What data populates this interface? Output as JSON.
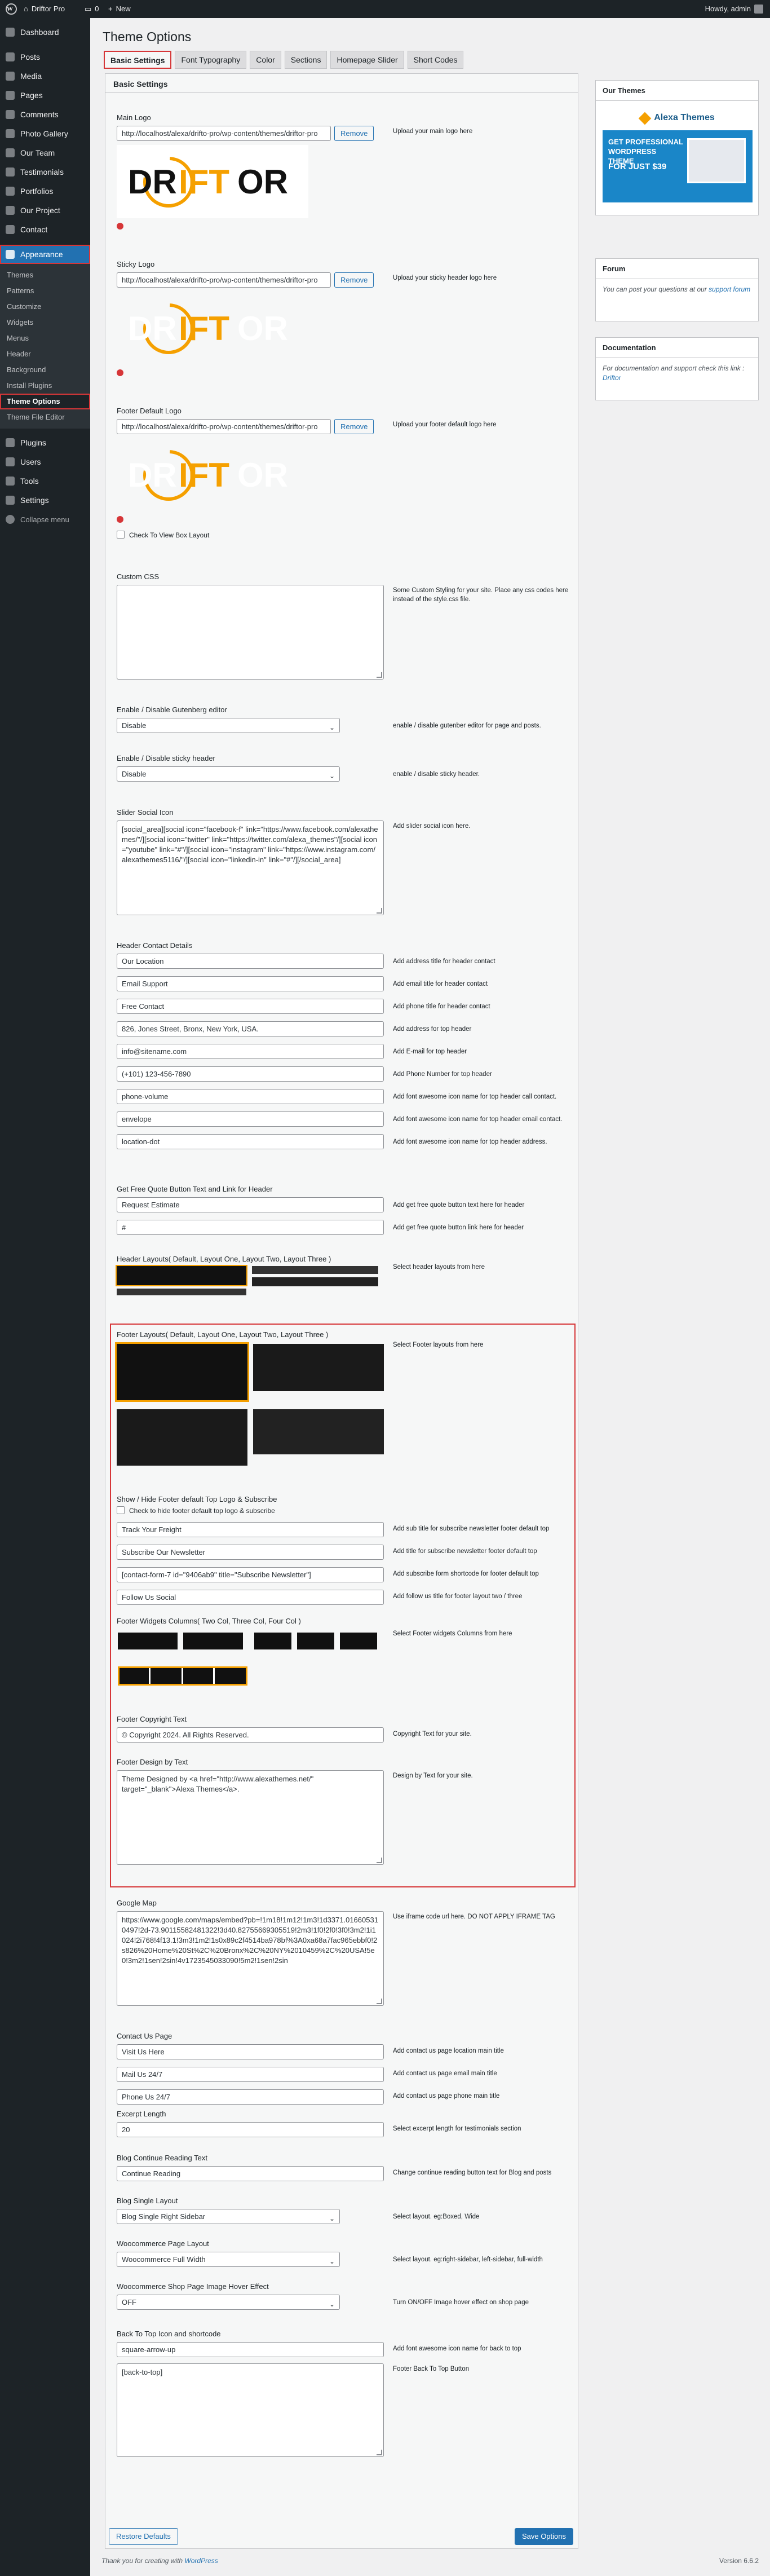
{
  "adminbar": {
    "site": "Driftor Pro",
    "comments": "0",
    "new": "New",
    "howdy": "Howdy, admin"
  },
  "sidebar": {
    "top": [
      "Dashboard"
    ],
    "items": [
      "Posts",
      "Media",
      "Pages",
      "Comments",
      "Photo Gallery",
      "Our Team",
      "Testimonials",
      "Portfolios",
      "Our Project",
      "Contact"
    ],
    "appearance": "Appearance",
    "appearance_sub": [
      "Themes",
      "Patterns",
      "Customize",
      "Widgets",
      "Menus",
      "Header",
      "Background",
      "Install Plugins",
      "Theme Options",
      "Theme File Editor"
    ],
    "bottom": [
      "Plugins",
      "Users",
      "Tools",
      "Settings",
      "Collapse menu"
    ]
  },
  "page": {
    "title": "Theme Options",
    "tabs": [
      "Basic Settings",
      "Font Typography",
      "Color",
      "Sections",
      "Homepage Slider",
      "Short Codes"
    ],
    "panel_title": "Basic Settings"
  },
  "fields": {
    "main_logo": {
      "label": "Main Logo",
      "value": "http://localhost/alexa/drifto-pro/wp-content/themes/driftor-pro",
      "remove": "Remove",
      "desc": "Upload your main logo here"
    },
    "sticky_logo": {
      "label": "Sticky Logo",
      "value": "http://localhost/alexa/drifto-pro/wp-content/themes/driftor-pro",
      "remove": "Remove",
      "desc": "Upload your sticky header logo here"
    },
    "footer_logo": {
      "label": "Footer Default Logo",
      "value": "http://localhost/alexa/drifto-pro/wp-content/themes/driftor-pro",
      "remove": "Remove",
      "desc": "Upload your footer default logo here"
    },
    "box_layout": "Check To View Box Layout",
    "custom_css": {
      "label": "Custom CSS",
      "value": "",
      "desc": "Some Custom Styling for your site. Place any css codes here instead of the style.css file."
    },
    "gutenberg": {
      "label": "Enable / Disable Gutenberg editor",
      "value": "Disable",
      "desc": "enable / disable gutenber editor for page and posts."
    },
    "sticky_header": {
      "label": "Enable / Disable sticky header",
      "value": "Disable",
      "desc": "enable / disable sticky header."
    },
    "slider_social": {
      "label": "Slider Social Icon",
      "value": "[social_area][social icon=\"facebook-f\" link=\"https://www.facebook.com/alexathemes/\"/][social icon=\"twitter\" link=\"https://twitter.com/alexa_themes\"/][social icon=\"youtube\" link=\"#\"/][social icon=\"instagram\" link=\"https://www.instagram.com/alexathemes5116/\"/][social icon=\"linkedin-in\" link=\"#\"/][/social_area]",
      "desc": "Add slider social icon here."
    },
    "header_contact": {
      "label": "Header Contact Details",
      "rows": [
        {
          "value": "Our Location",
          "desc": "Add address title for header contact"
        },
        {
          "value": "Email Support",
          "desc": "Add email title for header contact"
        },
        {
          "value": "Free Contact",
          "desc": "Add phone title for header contact"
        },
        {
          "value": "826, Jones Street, Bronx, New York, USA.",
          "desc": "Add address for top header"
        },
        {
          "value": "info@sitename.com",
          "desc": "Add E-mail for top header"
        },
        {
          "value": "(+101) 123-456-7890",
          "desc": "Add Phone Number for top header"
        },
        {
          "value": "phone-volume",
          "desc": "Add font awesome icon name for top header call contact."
        },
        {
          "value": "envelope",
          "desc": "Add font awesome icon name for top header email contact."
        },
        {
          "value": "location-dot",
          "desc": "Add font awesome icon name for top header address."
        }
      ]
    },
    "quote": {
      "label": "Get Free Quote Button Text and Link for Header",
      "rows": [
        {
          "value": "Request Estimate",
          "desc": "Add get free quote button text here for header"
        },
        {
          "value": "#",
          "desc": "Add get free quote button link here for header"
        }
      ]
    },
    "header_layouts": {
      "label": "Header Layouts( Default, Layout One, Layout Two, Layout Three )",
      "desc": "Select header layouts from here"
    },
    "footer_layouts": {
      "label": "Footer Layouts( Default, Layout One, Layout Two, Layout Three )",
      "desc": "Select Footer layouts from here"
    },
    "footer_top": {
      "label": "Show / Hide Footer default Top Logo & Subscribe",
      "check": "Check to hide footer default top logo & subscribe",
      "rows": [
        {
          "value": "Track Your Freight",
          "desc": "Add sub title for subscribe newsletter footer default top"
        },
        {
          "value": "Subscribe Our Newsletter",
          "desc": "Add title for subscribe newsletter footer default top"
        },
        {
          "value": "[contact-form-7 id=\"9406ab9\" title=\"Subscribe Newsletter\"]",
          "desc": "Add subscribe form shortcode for footer default top"
        },
        {
          "value": "Follow Us Social",
          "desc": "Add follow us title for footer layout two / three"
        }
      ]
    },
    "footer_columns": {
      "label": "Footer Widgets Columns( Two Col, Three Col, Four Col )",
      "desc": "Select Footer widgets Columns from here"
    },
    "copyright": {
      "label": "Footer Copyright Text",
      "value": "© Copyright 2024. All Rights Reserved.",
      "desc": "Copyright Text for your site."
    },
    "design_by": {
      "label": "Footer Design by Text",
      "value": "Theme Designed by <a href=\"http://www.alexathemes.net/\" target=\"_blank\">Alexa Themes</a>.",
      "desc": "Design by Text for your site."
    },
    "google_map": {
      "label": "Google Map",
      "value": "https://www.google.com/maps/embed?pb=!1m18!1m12!1m3!1d3371.016605310497!2d-73.90115582481322!3d40.82755669305519!2m3!1f0!2f0!3f0!3m2!1i1024!2i768!4f13.1!3m3!1m2!1s0x89c2f4514ba978bf%3A0xa68a7fac965ebbf0!2s826%20Home%20St%2C%20Bronx%2C%20NY%2010459%2C%20USA!5e0!3m2!1sen!2sin!4v1723545033090!5m2!1sen!2sin",
      "desc": "Use iframe code url here. DO NOT APPLY IFRAME TAG"
    },
    "contact_page": {
      "label": "Contact Us Page",
      "rows": [
        {
          "value": "Visit Us Here",
          "desc": "Add contact us page location main title"
        },
        {
          "value": "Mail Us 24/7",
          "desc": "Add contact us page email main title"
        },
        {
          "value": "Phone Us 24/7",
          "desc": "Add contact us page phone main title"
        }
      ]
    },
    "excerpt": {
      "label": "Excerpt Length",
      "value": "20",
      "desc": "Select excerpt length for testimonials section"
    },
    "blog_read": {
      "label": "Blog Continue Reading Text",
      "value": "Continue Reading",
      "desc": "Change continue reading button text for Blog and posts"
    },
    "blog_single": {
      "label": "Blog Single Layout",
      "value": "Blog Single Right Sidebar",
      "desc": "Select layout. eg:Boxed, Wide"
    },
    "woo_layout": {
      "label": "Woocommerce Page Layout",
      "value": "Woocommerce Full Width",
      "desc": "Select layout. eg:right-sidebar, left-sidebar, full-width"
    },
    "woo_hover": {
      "label": "Woocommerce Shop Page Image Hover Effect",
      "value": "OFF",
      "desc": "Turn ON/OFF Image hover effect on shop page"
    },
    "back_top": {
      "label": "Back To Top Icon and shortcode",
      "value": "square-arrow-up",
      "desc": "Add font awesome icon name for back to top",
      "shortcode": "[back-to-top]",
      "shortcode_desc": "Footer Back To Top Button"
    }
  },
  "actions": {
    "restore": "Restore Defaults",
    "save": "Save Options"
  },
  "side": {
    "our_themes": "Our Themes",
    "promo_brand": "Alexa Themes",
    "promo_text": "GET PROFESSIONAL WORDPRESS THEME",
    "promo_price": "FOR JUST $39",
    "forum": {
      "title": "Forum",
      "text": "You can post your questions at our",
      "link": "support forum"
    },
    "docs": {
      "title": "Documentation",
      "text": "For documentation and support check this link :",
      "link": "Driftor"
    }
  },
  "footer": {
    "thanks": "Thank you for creating with",
    "wp": "WordPress",
    "version": "Version 6.6.2"
  },
  "logo_text": {
    "dr": "DR",
    "ift": "IFT",
    "or": "OR"
  },
  "colors": {
    "accent": "#2271b1",
    "highlight": "#d63638",
    "orange": "#f5a000"
  }
}
